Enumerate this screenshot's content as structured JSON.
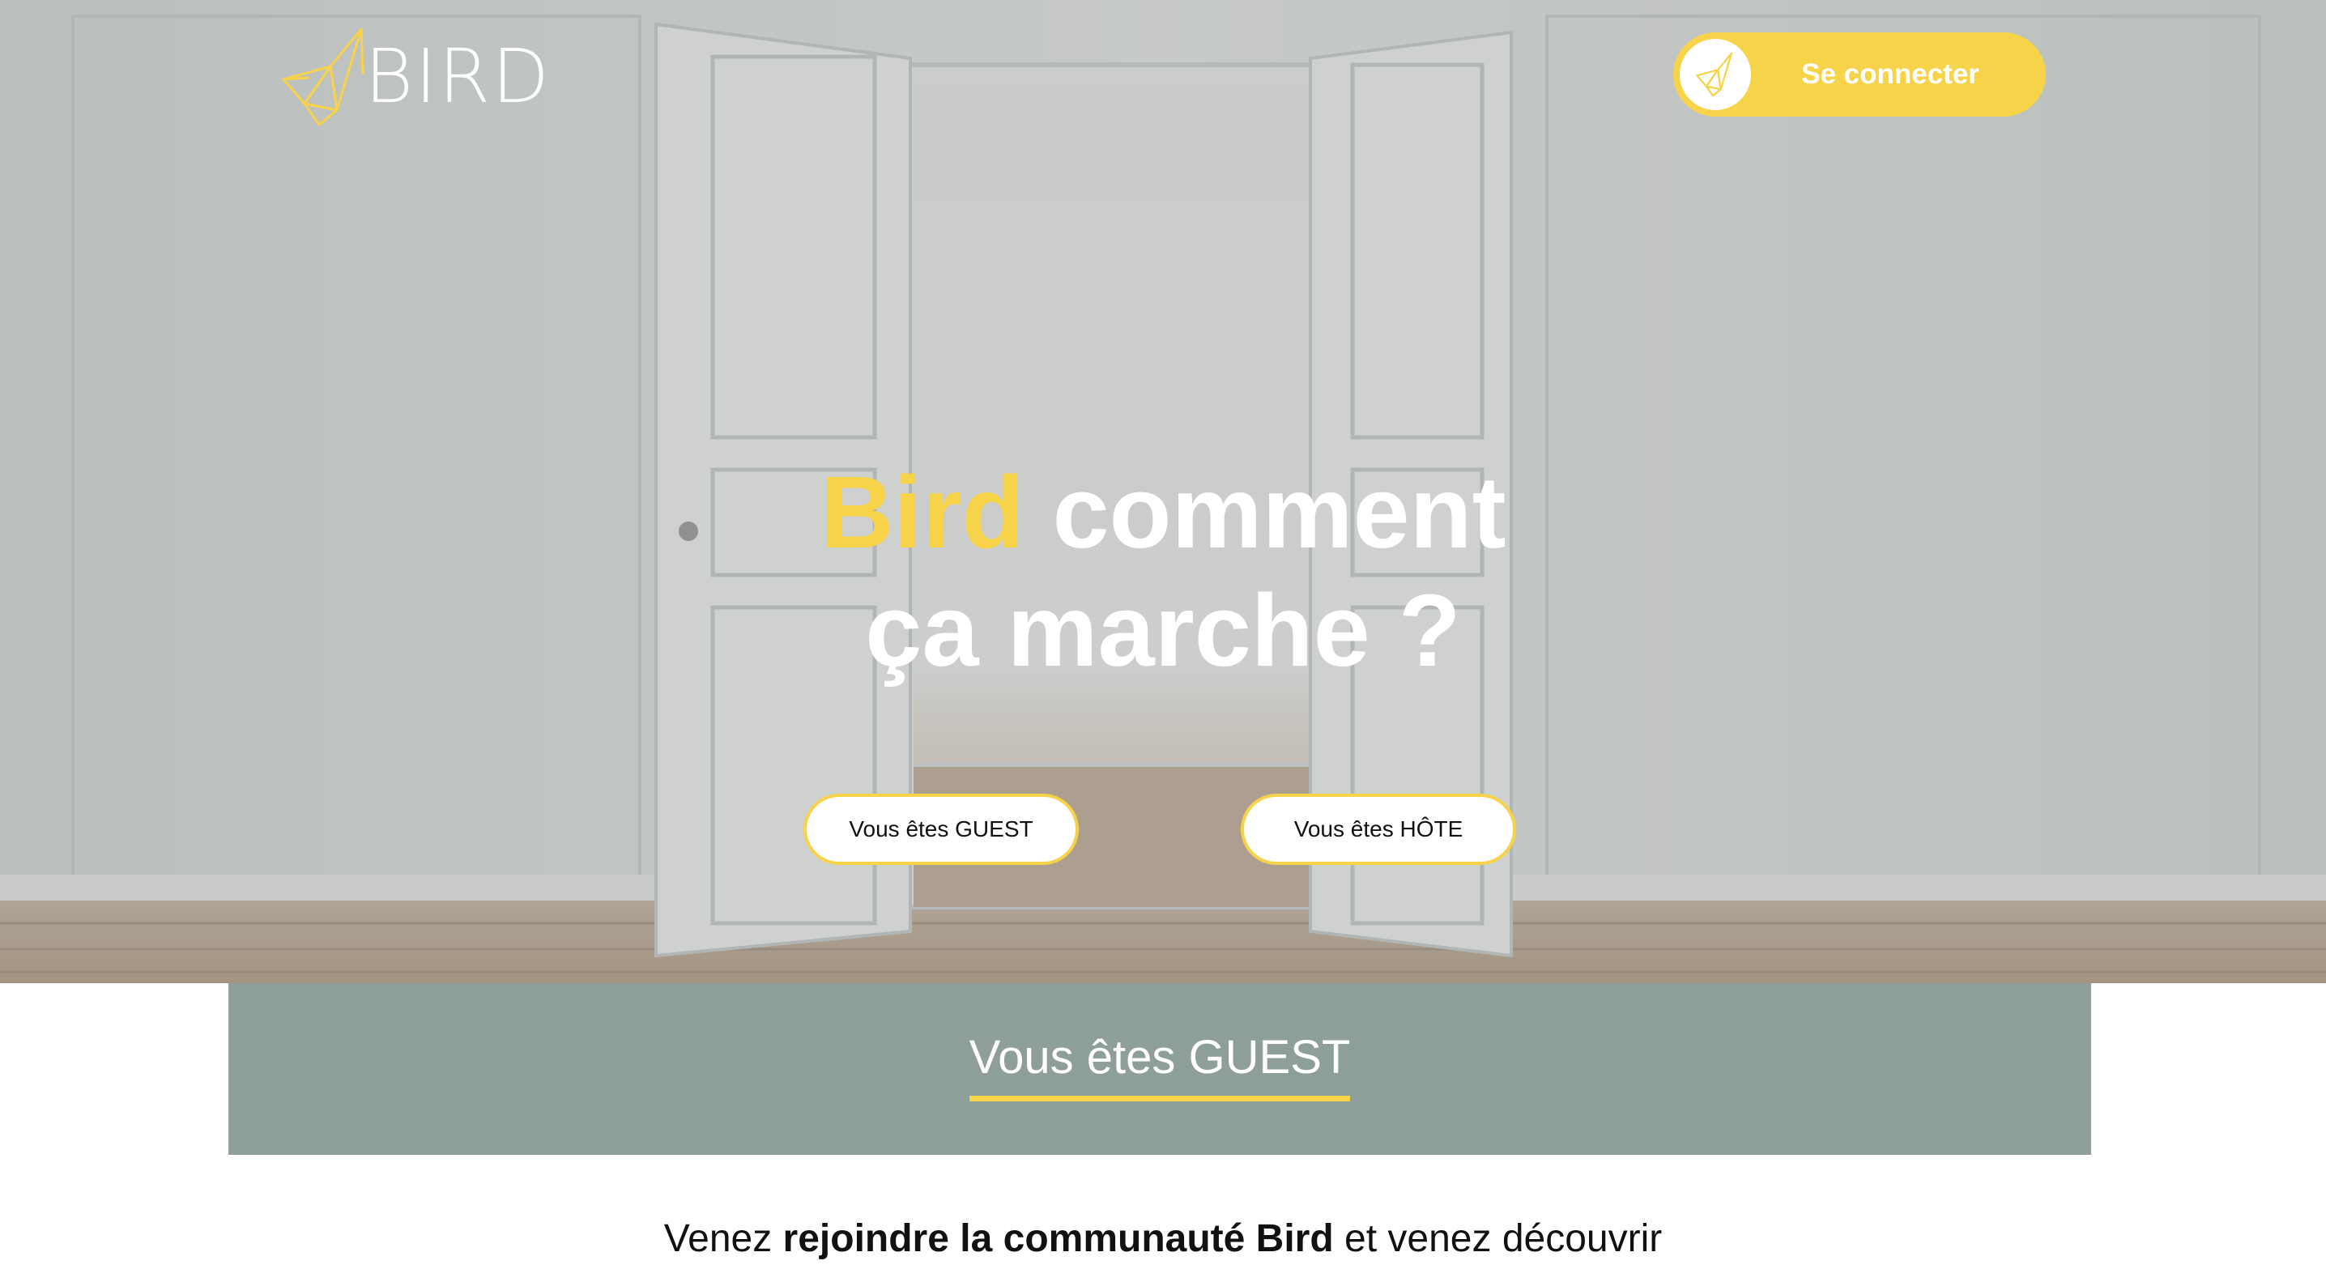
{
  "brand": {
    "logo_text": "BIRD",
    "accent_color": "#f7d34a",
    "section_color": "#8e9f9a",
    "logo_icon": "origami-bird-icon"
  },
  "header": {
    "connect_label": "Se connecter",
    "connect_icon": "origami-bird-icon"
  },
  "hero": {
    "title_accent": "Bird",
    "title_line1_rest": " comment",
    "title_line2": "ça marche ?",
    "guest_button": "Vous êtes GUEST",
    "host_button": "Vous êtes HÔTE",
    "background": "open-white-double-doors-photo"
  },
  "section": {
    "title": "Vous êtes GUEST"
  },
  "intro": {
    "prefix": "Venez ",
    "bold": "rejoindre la communauté Bird",
    "suffix": " et venez découvrir"
  }
}
